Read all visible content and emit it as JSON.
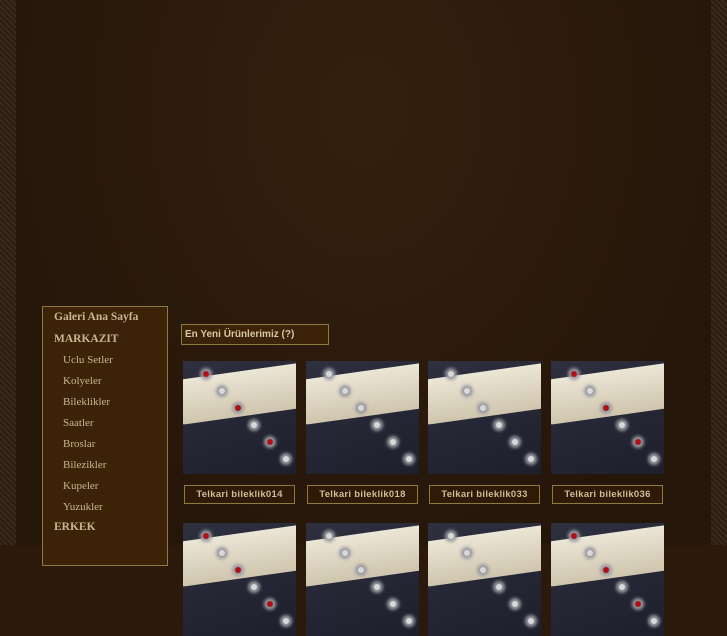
{
  "sidebar": {
    "items": [
      {
        "label": "Galeri Ana Sayfa",
        "type": "cat"
      },
      {
        "label": "MARKAZIT",
        "type": "cat"
      },
      {
        "label": "Uclu Setler",
        "type": "sub"
      },
      {
        "label": "Kolyeler",
        "type": "sub"
      },
      {
        "label": "Bileklikler",
        "type": "sub"
      },
      {
        "label": "Saatler",
        "type": "sub"
      },
      {
        "label": "Broslar",
        "type": "sub"
      },
      {
        "label": "Bilezikler",
        "type": "sub"
      },
      {
        "label": "Kupeler",
        "type": "sub"
      },
      {
        "label": "Yuzukler",
        "type": "sub"
      },
      {
        "label": "ERKEK",
        "type": "cat"
      }
    ]
  },
  "main": {
    "section_title": "En Yeni Ürünlerimiz (?)",
    "products": [
      {
        "name": "Telkari bileklik014",
        "gems": true
      },
      {
        "name": "Telkari bileklik018",
        "gems": false
      },
      {
        "name": "Telkari bileklik033",
        "gems": false
      },
      {
        "name": "Telkari bileklik036",
        "gems": true
      }
    ]
  },
  "colors": {
    "border": "#8c7a3e",
    "panel": "#3c2308",
    "background": "#2b1a0b"
  }
}
